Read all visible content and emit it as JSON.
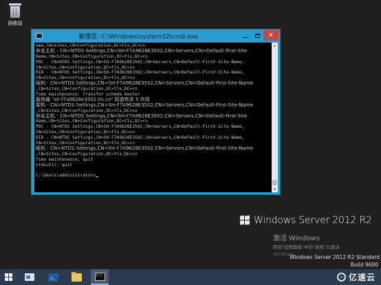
{
  "desktop": {
    "recycle_bin_label": "回收站"
  },
  "window": {
    "title": "管理员: C:\\Windows\\system32\\cmd.exe",
    "minimize_icon": "minimize-icon",
    "maximize_icon": "maximize-icon",
    "close_label": "✕"
  },
  "console": {
    "lines": [
      "ame,CN=Sites,CN=Configuration,DC=tls,DC=cn",
      "命名主机 - CN=NTDS Settings,CN=SH-F7A9628E3502,CN=Servers,CN=Default-First-Site-",
      "Name,CN=Sites,CN=Configuration,DC=tls,DC=cn",
      "PDC - CN=NTDS Settings,CN=SH-F7A9628E3502,CN=Servers,CN=Default-First-Site-Name,",
      "CN=Sites,CN=Configuration,DC=tls,DC=cn",
      "RID - CN=NTDS Settings,CN=SH-F7A9628E3502,CN=Servers,CN=Default-First-Site-Name,",
      "CN=Sites,CN=Configuration,DC=tls,DC=cn",
      "结构 - CN=NTDS Settings,CN=SH-F7A9628E3502,CN=Servers,CN=Default-First-Site-Name",
      ",CN=Sites,CN=Configuration,DC=tls,DC=cn",
      "fsmo maintenance: transfer schema master",
      "服务器 \"sh-f7a9628e3502.tls.cn\" 知道有关 5 作用",
      "架构 - CN=NTDS Settings,CN=SH-F7A9628E3502,CN=Servers,CN=Default-First-Site-Name",
      ",CN=Sites,CN=Configuration,DC=tls,DC=cn",
      "命名主机 - CN=NTDS Settings,CN=SH-F7A9628E3502,CN=Servers,CN=Default-First-Site-",
      "Name,CN=Sites,CN=Configuration,DC=tls,DC=cn",
      "PDC - CN=NTDS Settings,CN=SH-F7A9628E3502,CN=Servers,CN=Default-First-Site-Name,",
      "CN=Sites,CN=Configuration,DC=tls,DC=cn",
      "RID - CN=NTDS Settings,CN=SH-F7A9628E3502,CN=Servers,CN=Default-First-Site-Name,",
      "CN=Sites,CN=Configuration,DC=tls,DC=cn",
      "结构 - CN=NTDS Settings,CN=SH-F7A9628E3502,CN=Servers,CN=Default-First-Site-Name",
      ",CN=Sites,CN=Configuration,DC=tls,DC=cn",
      "fsmo maintenance: quit",
      "ntdsutil: quit",
      "",
      "C:\\Users\\administrator>"
    ]
  },
  "branding": {
    "product": "Windows Server 2012 R2",
    "activate_title": "激活 Windows",
    "activate_hint": "转到\"控制面板\"中的\"系统\"以激活",
    "activate_ghost": "Windows。",
    "edition": "Windows Server 2012 R2 Standard",
    "build": "Build 9600"
  },
  "taskbar": {
    "items": [
      "start-icon",
      "server-manager-icon",
      "powershell-icon",
      "file-explorer-icon",
      "cmd-icon"
    ],
    "powershell_glyph": "›_"
  },
  "watermark": {
    "text": "亿速云"
  },
  "colors": {
    "desktop": "#1f1f1f",
    "window_frame": "#2c9bd4",
    "console_bg": "#000000",
    "console_fg": "#c8c8c8",
    "close_button": "#c74545",
    "taskbar": "#2b3a4f"
  }
}
